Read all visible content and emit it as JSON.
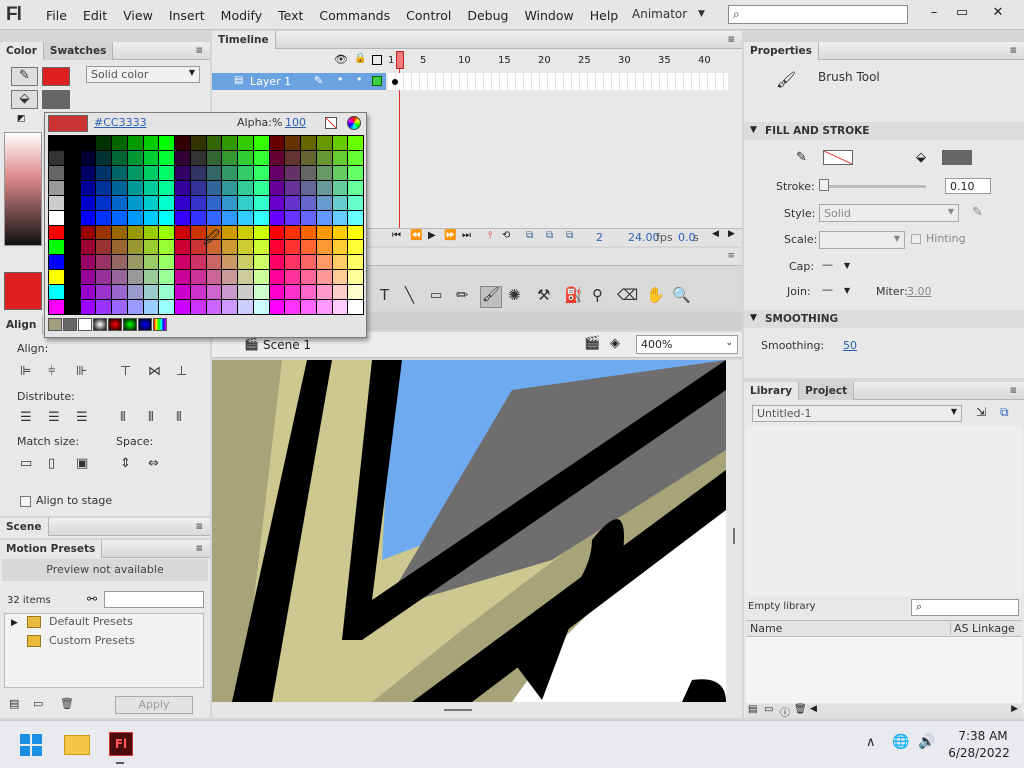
{
  "app": {
    "logo": "Fl",
    "workspace": "Animator"
  },
  "menu": [
    "File",
    "Edit",
    "View",
    "Insert",
    "Modify",
    "Text",
    "Commands",
    "Control",
    "Debug",
    "Window",
    "Help"
  ],
  "window_buttons": {
    "minimize": "–",
    "restore": "▭",
    "close": "✕"
  },
  "color_panel": {
    "tabs": [
      "Color",
      "Swatches"
    ],
    "fill_type": "Solid color",
    "stroke_color": "#dc1f1f",
    "fill_color": "#666666",
    "big_swatch": "#dc1f1f"
  },
  "color_popup": {
    "hex": "#CC3333",
    "alpha_label": "Alpha:%",
    "alpha_value": "100",
    "swatch": "#cc3333"
  },
  "align_panel": {
    "tab": "Align",
    "align_label": "Align:",
    "distribute_label": "Distribute:",
    "match_label": "Match size:",
    "space_label": "Space:",
    "stage_checkbox": "Align to stage"
  },
  "scene_panel": {
    "tab": "Scene"
  },
  "motion_presets": {
    "tab": "Motion Presets",
    "preview": "Preview not available",
    "count": "32 items",
    "folders": [
      "Default Presets",
      "Custom Presets"
    ],
    "apply": "Apply"
  },
  "timeline": {
    "tab": "Timeline",
    "layer": "Layer 1",
    "frame_numbers": [
      "1",
      "5",
      "10",
      "15",
      "20",
      "25",
      "30",
      "35",
      "40"
    ],
    "current_frame": "2",
    "fps": "24.00",
    "fps_unit": "fps",
    "time": "0.0",
    "time_unit": "s"
  },
  "stage": {
    "scene": "Scene 1",
    "zoom": "400%"
  },
  "properties": {
    "tab": "Properties",
    "tool": "Brush Tool",
    "fill_stroke_section": "FILL AND STROKE",
    "stroke_label": "Stroke:",
    "stroke_value": "0.10",
    "style_label": "Style:",
    "style_value": "Solid",
    "scale_label": "Scale:",
    "hinting": "Hinting",
    "cap_label": "Cap:",
    "join_label": "Join:",
    "miter_label": "Miter:",
    "miter_value": "3.00",
    "smoothing_section": "SMOOTHING",
    "smoothing_label": "Smoothing:",
    "smoothing_value": "50",
    "stroke_color": "#ffffff",
    "fill_color": "#666666"
  },
  "library": {
    "tabs": [
      "Library",
      "Project"
    ],
    "document": "Untitled-1",
    "empty": "Empty library",
    "col_name": "Name",
    "col_linkage": "AS Linkage"
  },
  "taskbar": {
    "time": "7:38 AM",
    "date": "6/28/2022",
    "flash_icon": "Fl"
  }
}
